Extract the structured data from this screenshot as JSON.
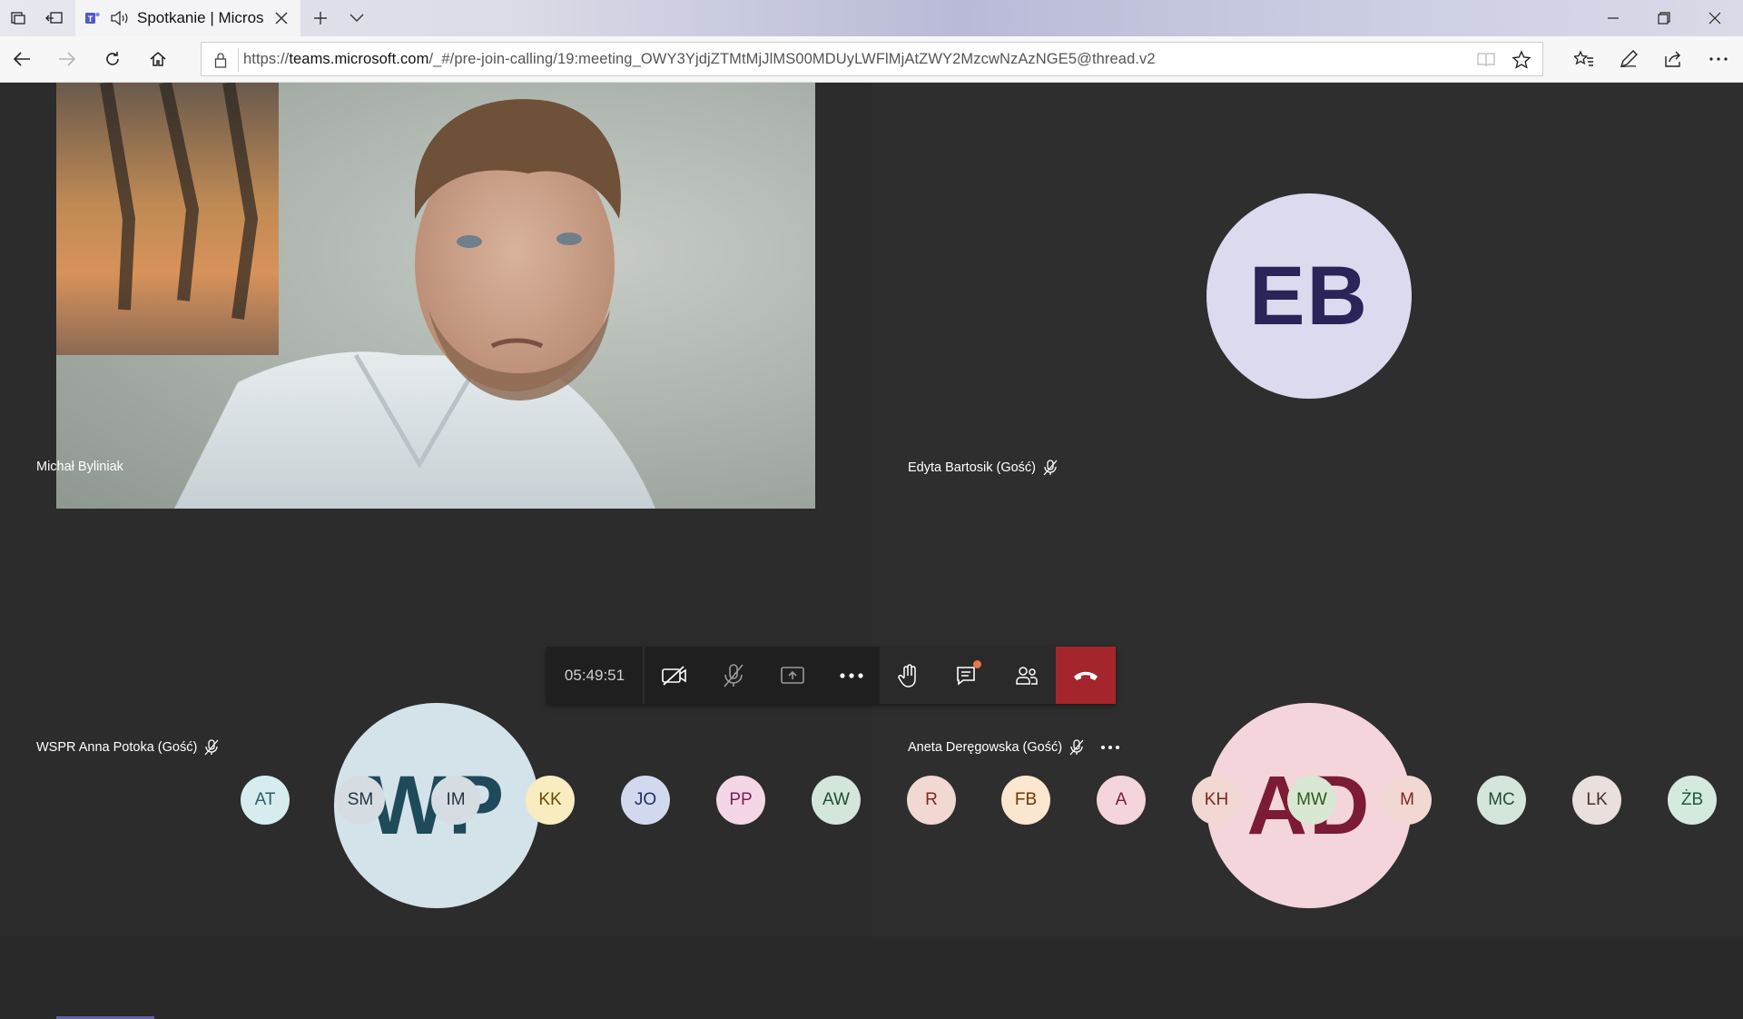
{
  "browser": {
    "tab_title": "Spotkanie | Microsc",
    "url_prefix": "https://",
    "url_domain": "teams.microsoft.com",
    "url_path": "/_#/pre-join-calling/19:meeting_OWY3YjdjZTMtMjJlMS00MDUyLWFlMjAtZWY2MzcwNzAzNGE5@thread.v2"
  },
  "tiles": [
    {
      "name": "Michał Byliniak",
      "type": "video"
    },
    {
      "name": "Edyta Bartosik (Gość)",
      "initials": "EB",
      "bg": "#dcdaee",
      "fg": "#2b2459",
      "muted": true
    },
    {
      "name": "WSPR Anna Potoka (Gość)",
      "initials": "WP",
      "bg": "#d4e2ea",
      "fg": "#1e4a5a",
      "muted": true
    },
    {
      "name": "Aneta Deręgowska (Gość)",
      "initials": "AD",
      "bg": "#f4d5dc",
      "fg": "#7b1b35",
      "muted": true
    }
  ],
  "controls": {
    "timer": "05:49:51",
    "hangup_color": "#a4262c",
    "chat_badge_color": "#e97548"
  },
  "strip": [
    {
      "initials": "AT",
      "bg": "#d7ecef",
      "fg": "#2e5d66"
    },
    {
      "initials": "SM",
      "bg": "#d6dde2",
      "fg": "#223642"
    },
    {
      "initials": "IM",
      "bg": "#d6dde2",
      "fg": "#223642"
    },
    {
      "initials": "KK",
      "bg": "#f9ecc0",
      "fg": "#6a4d00"
    },
    {
      "initials": "JO",
      "bg": "#d2d9ef",
      "fg": "#1f2f66"
    },
    {
      "initials": "PP",
      "bg": "#f4d7e7",
      "fg": "#7a1e55"
    },
    {
      "initials": "AW",
      "bg": "#d4e6dc",
      "fg": "#1f4f33"
    },
    {
      "initials": "R",
      "bg": "#f2d8d2",
      "fg": "#7a2a1a"
    },
    {
      "initials": "FB",
      "bg": "#fbe6cf",
      "fg": "#6b3a00"
    },
    {
      "initials": "A",
      "bg": "#f4d5dc",
      "fg": "#7b1b35"
    },
    {
      "initials": "KH",
      "bg": "#f2d8d2",
      "fg": "#7a2a1a"
    },
    {
      "initials": "MW",
      "bg": "#d8e8d2",
      "fg": "#2e5a1a"
    },
    {
      "initials": "M",
      "bg": "#f2d8d2",
      "fg": "#7a2a1a"
    },
    {
      "initials": "MC",
      "bg": "#d4e6dc",
      "fg": "#1f4f33"
    },
    {
      "initials": "LK",
      "bg": "#e9dfdc",
      "fg": "#4a2f28"
    },
    {
      "initials": "ŻB",
      "bg": "#d4eadf",
      "fg": "#1f5a3a"
    }
  ]
}
